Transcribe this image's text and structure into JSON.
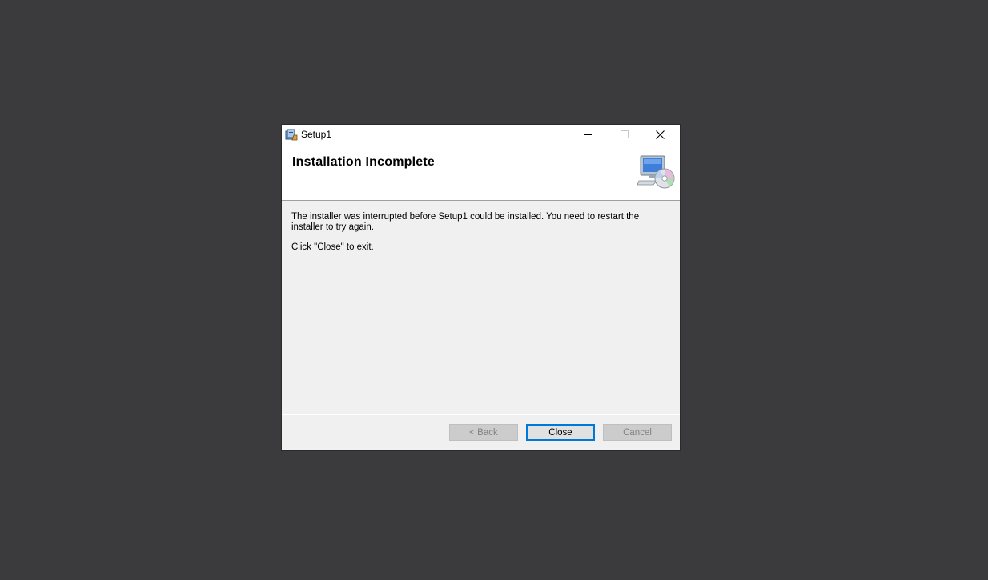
{
  "window": {
    "title": "Setup1"
  },
  "header": {
    "title": "Installation Incomplete"
  },
  "content": {
    "message": "The installer was interrupted before Setup1 could be installed. You need to restart the installer to try again.",
    "instruction": "Click \"Close\" to exit."
  },
  "buttons": {
    "back_label": "< Back",
    "close_label": "Close",
    "cancel_label": "Cancel"
  },
  "icons": {
    "app": "installer-app-icon",
    "header": "computer-cd-icon",
    "minimize": "minimize-icon",
    "maximize": "maximize-icon",
    "close": "close-icon"
  },
  "colors": {
    "desktop_background": "#3b3b3d",
    "dialog_body": "#f0f0f0",
    "focus_accent": "#0078d7"
  }
}
